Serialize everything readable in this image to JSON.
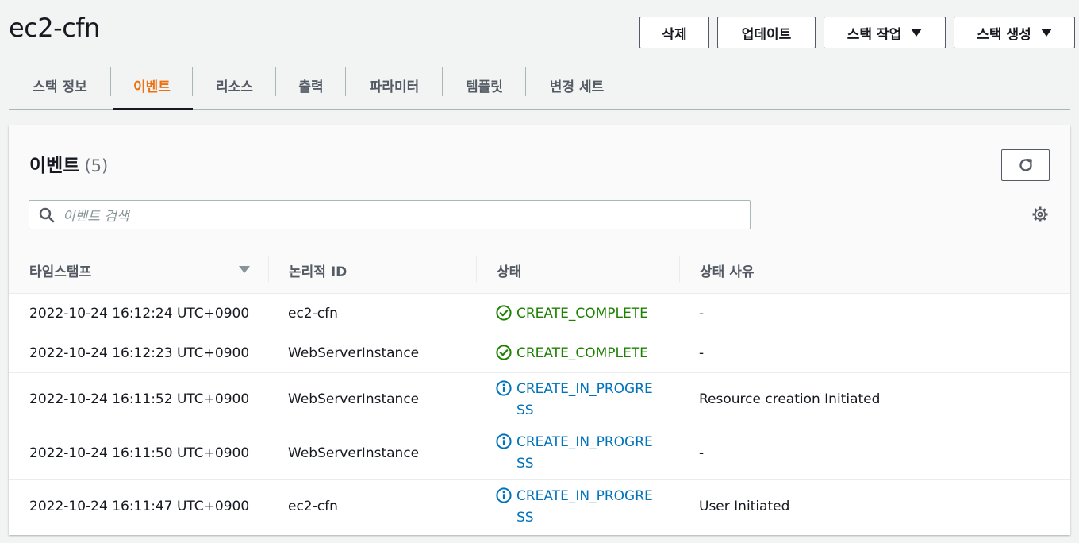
{
  "page": {
    "title": "ec2-cfn"
  },
  "actions": {
    "delete": "삭제",
    "update": "업데이트",
    "stack_actions": "스택 작업",
    "create_stack": "스택 생성"
  },
  "tabs": [
    {
      "label": "스택 정보"
    },
    {
      "label": "이벤트",
      "active": true
    },
    {
      "label": "리소스"
    },
    {
      "label": "출력"
    },
    {
      "label": "파라미터"
    },
    {
      "label": "템플릿"
    },
    {
      "label": "변경 세트"
    }
  ],
  "events": {
    "title": "이벤트",
    "count": "(5)",
    "search_placeholder": "이벤트 검색",
    "columns": [
      "타임스탬프",
      "논리적 ID",
      "상태",
      "상태 사유"
    ],
    "rows": [
      {
        "timestamp": "2022-10-24 16:12:24 UTC+0900",
        "logical_id": "ec2-cfn",
        "status": "CREATE_COMPLETE",
        "status_kind": "success",
        "reason": "-"
      },
      {
        "timestamp": "2022-10-24 16:12:23 UTC+0900",
        "logical_id": "WebServerInstance",
        "status": "CREATE_COMPLETE",
        "status_kind": "success",
        "reason": "-"
      },
      {
        "timestamp": "2022-10-24 16:11:52 UTC+0900",
        "logical_id": "WebServerInstance",
        "status": "CREATE_IN_PROGRESS",
        "status_kind": "info",
        "reason": "Resource creation Initiated"
      },
      {
        "timestamp": "2022-10-24 16:11:50 UTC+0900",
        "logical_id": "WebServerInstance",
        "status": "CREATE_IN_PROGRESS",
        "status_kind": "info",
        "reason": "-"
      },
      {
        "timestamp": "2022-10-24 16:11:47 UTC+0900",
        "logical_id": "ec2-cfn",
        "status": "CREATE_IN_PROGRESS",
        "status_kind": "info",
        "reason": "User Initiated"
      }
    ]
  },
  "colors": {
    "accent": "#ec7211",
    "success": "#1d8102",
    "info": "#0073bb"
  }
}
